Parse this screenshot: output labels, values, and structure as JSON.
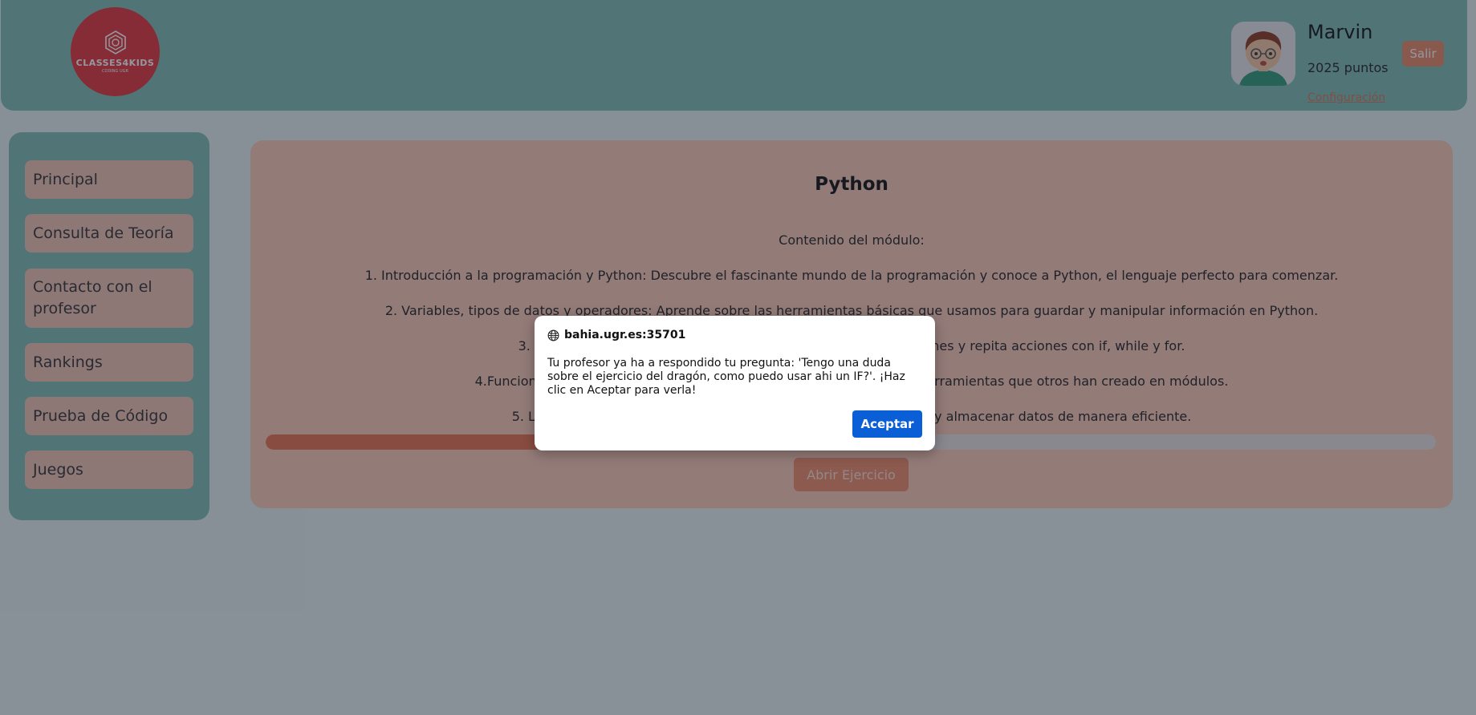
{
  "header": {
    "logo_text": "CLASSES4KIDS",
    "logo_sub": "CODING UGR",
    "user_name": "Marvin",
    "user_points": "2025 puntos",
    "config_link": "Configuración",
    "logout_label": "Salir"
  },
  "sidebar": {
    "items": [
      {
        "label": "Principal"
      },
      {
        "label": "Consulta de Teoría"
      },
      {
        "label": "Contacto con el profesor"
      },
      {
        "label": "Rankings"
      },
      {
        "label": "Prueba de Código"
      },
      {
        "label": "Juegos"
      }
    ]
  },
  "module": {
    "title": "Python",
    "subtitle": "Contenido del módulo:",
    "lines": [
      "1. Introducción a la programación y Python: Descubre el fascinante mundo de la programación y conoce a Python, el lenguaje perfecto para comenzar.",
      "2. Variables, tipos de datos y operadores: Aprende sobre las herramientas básicas que usamos para guardar y manipular información en Python.",
      "3. Estructuras de control: Enseña a tu programa a tomar decisiones y repita acciones con if, while y for.",
      "4.Funciones y módulos: Crea tus propias funciones y aprende a usar herramientas que otros han creado en módulos.",
      "5. Listas, tuplas y diccionarios: Descubre cómo organizar, utilizar y almacenar datos de manera eficiente."
    ],
    "progress": 0.42,
    "open_label": "Abrir Ejercicio"
  },
  "dialog": {
    "origin": "bahia.ugr.es:35701",
    "message": "Tu profesor ya ha a respondido tu pregunta: 'Tengo una duda sobre el ejercicio del dragón, como puedo usar ahi un IF?'. ¡Haz clic en Aceptar para verla!",
    "accept_label": "Aceptar"
  },
  "colors": {
    "teal": "#7fbdb1",
    "salmon": "#fbcab5",
    "accent": "#e8724f",
    "dialog_button": "#0b5fd6"
  }
}
